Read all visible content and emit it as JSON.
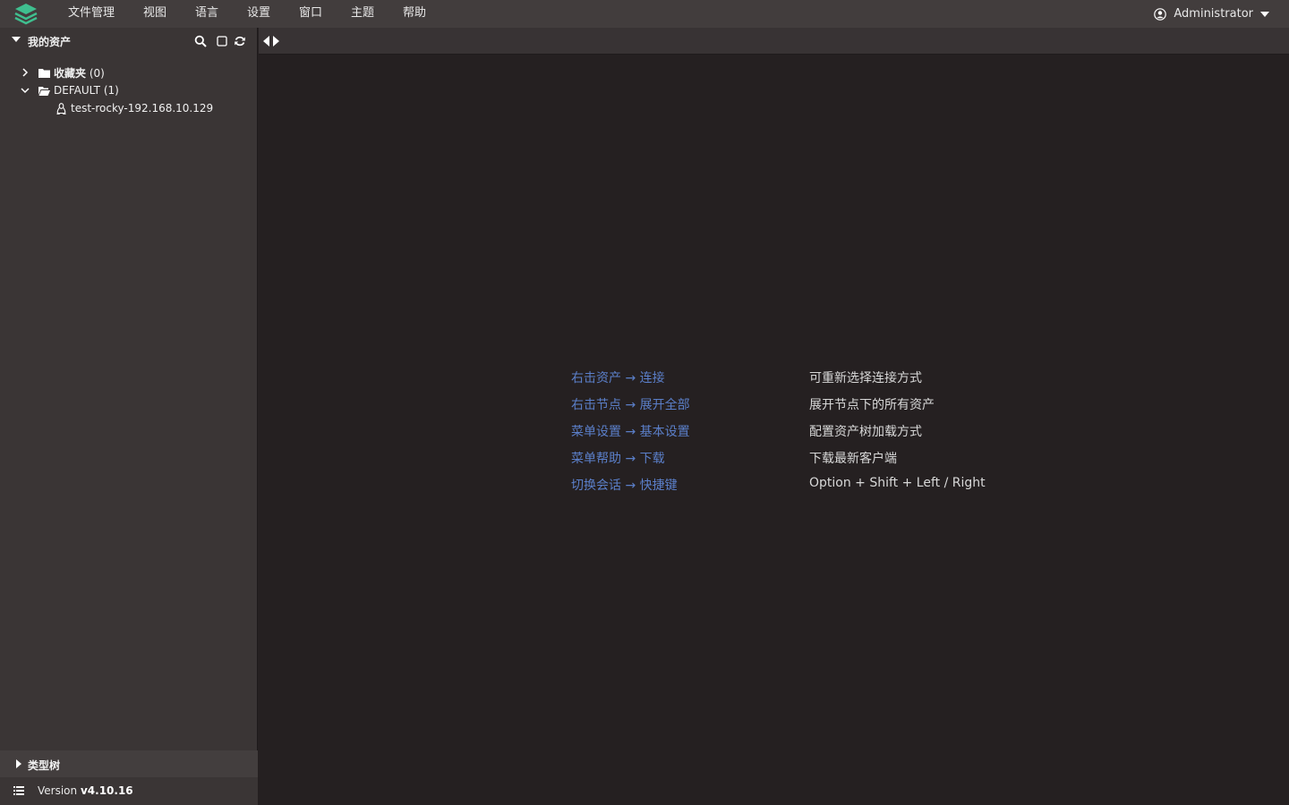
{
  "menubar": {
    "items": [
      "文件管理",
      "视图",
      "语言",
      "设置",
      "窗口",
      "主题",
      "帮助"
    ],
    "user": "Administrator",
    "accent_color": "#3fbf8f"
  },
  "sidebar": {
    "title": "我的资产",
    "icons": [
      "search-icon",
      "square-icon",
      "refresh-icon"
    ],
    "tree": [
      {
        "name": "收藏夹",
        "count": "(0)",
        "expanded": false
      },
      {
        "name": "DEFAULT",
        "count": "(1)",
        "expanded": true
      },
      {
        "name": "test-rocky-192.168.10.129",
        "icon": "linux-icon"
      }
    ],
    "type_tree_label": "类型树",
    "version_label": "Version",
    "version_number": "v4.10.16"
  },
  "hints": [
    {
      "action": "右击资产 → 连接",
      "description": "可重新选择连接方式"
    },
    {
      "action": "右击节点 → 展开全部",
      "description": "展开节点下的所有资产"
    },
    {
      "action": "菜单设置 → 基本设置",
      "description": "配置资产树加载方式"
    },
    {
      "action": "菜单帮助 → 下载",
      "description": "下载最新客户端"
    },
    {
      "action": "切换会话 → 快捷键",
      "description": "Option + Shift + Left / Right"
    }
  ],
  "colors": {
    "hint_action": "#5b7fc9",
    "background": "#252021",
    "sidebar": "#3a3535"
  }
}
